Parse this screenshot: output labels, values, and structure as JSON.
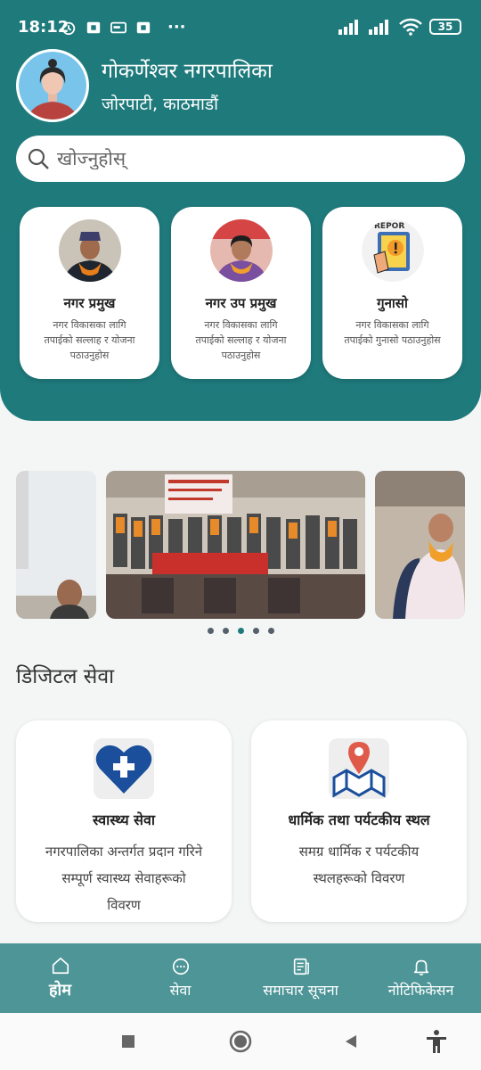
{
  "status_bar": {
    "time": "18:12",
    "more": "···",
    "battery": "35"
  },
  "header": {
    "municipality_name": "गोकर्णेश्वर नगरपालिका",
    "address": "जोरपाटी, काठमाडौं"
  },
  "search": {
    "placeholder": "खोज्नुहोस्"
  },
  "leader_cards": [
    {
      "title": "नगर प्रमुख",
      "desc_line1": "नगर विकासका लागि",
      "desc_line2": "तपाईको सल्लाह र योजना",
      "desc_line3": "पठाउनुहोस"
    },
    {
      "title": "नगर उप प्रमुख",
      "desc_line1": "नगर विकासका लागि",
      "desc_line2": "तपाईको सल्लाह र योजना",
      "desc_line3": "पठाउनुहोस"
    },
    {
      "title": "गुनासो",
      "desc_line1": "नगर विकासका लागि",
      "desc_line2": "तपाईको गुनासो पठाउनुहोस",
      "desc_line3": ""
    }
  ],
  "complaint_icon_text": "REPOR",
  "carousel": {
    "dot_count": 5,
    "active_index": 2
  },
  "digital_services": {
    "title": "डिजिटल सेवा",
    "cards": [
      {
        "title": "स्वास्थ्य सेवा",
        "desc_line1": "नगरपालिका अन्तर्गत प्रदान गरिने",
        "desc_line2": "सम्पूर्ण स्वास्थ्य सेवाहरूको",
        "desc_line3": "विवरण",
        "icon": "heart-cross-icon"
      },
      {
        "title": "धार्मिक तथा पर्यटकीय स्थल",
        "desc_line1": "समग्र धार्मिक र पर्यटकीय",
        "desc_line2": "स्थलहरूको विवरण",
        "desc_line3": "",
        "icon": "map-pin-icon"
      }
    ]
  },
  "bottom_nav": [
    {
      "label": "होम",
      "icon": "home-icon",
      "active": true
    },
    {
      "label": "सेवा",
      "icon": "chat-icon",
      "active": false
    },
    {
      "label": "समाचार सूचना",
      "icon": "news-icon",
      "active": false
    },
    {
      "label": "नोटिफिकेसन",
      "icon": "bell-icon",
      "active": false
    }
  ],
  "colors": {
    "primary": "#1f7a7c",
    "nav": "#4e9597",
    "heart": "#1b4f9c",
    "pin": "#e05a4a"
  }
}
